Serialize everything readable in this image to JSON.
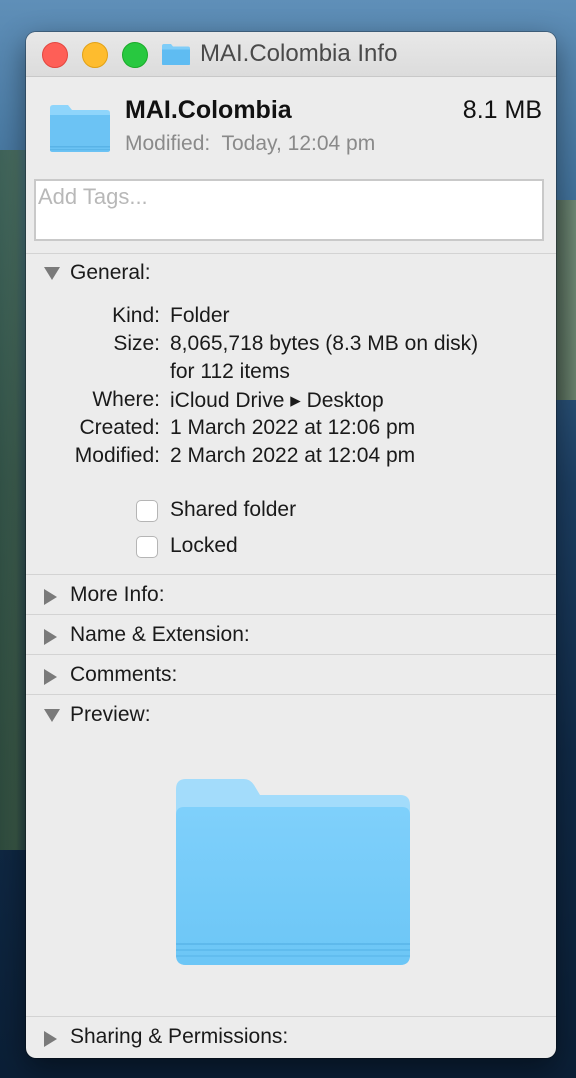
{
  "window": {
    "title": "MAI.Colombia Info"
  },
  "header": {
    "name": "MAI.Colombia",
    "size": "8.1 MB",
    "modified": "Modified:  Today, 12:04 pm"
  },
  "tags": {
    "placeholder": "Add Tags..."
  },
  "sections": {
    "general": "General:",
    "more_info": "More Info:",
    "name_extension": "Name & Extension:",
    "comments": "Comments:",
    "preview": "Preview:",
    "sharing": "Sharing & Permissions:"
  },
  "general": {
    "kind_label": "Kind:",
    "kind_value": "Folder",
    "size_label": "Size:",
    "size_value": "8,065,718 bytes (8.3 MB on disk)",
    "size_value2": "for 112 items",
    "where_label": "Where:",
    "where_value": "iCloud Drive ▸ Desktop",
    "created_label": "Created:",
    "created_value": "1 March 2022 at 12:06 pm",
    "modified_label": "Modified:",
    "modified_value": "2 March 2022 at 12:04 pm",
    "shared_folder": "Shared folder",
    "locked": "Locked"
  },
  "colors": {
    "folder_blue": "#6cc3f4",
    "close": "#fe5f57",
    "minimize": "#febc2e",
    "zoom": "#28c840"
  },
  "icons": [
    "folder-icon",
    "disclosure-triangle-icon"
  ]
}
